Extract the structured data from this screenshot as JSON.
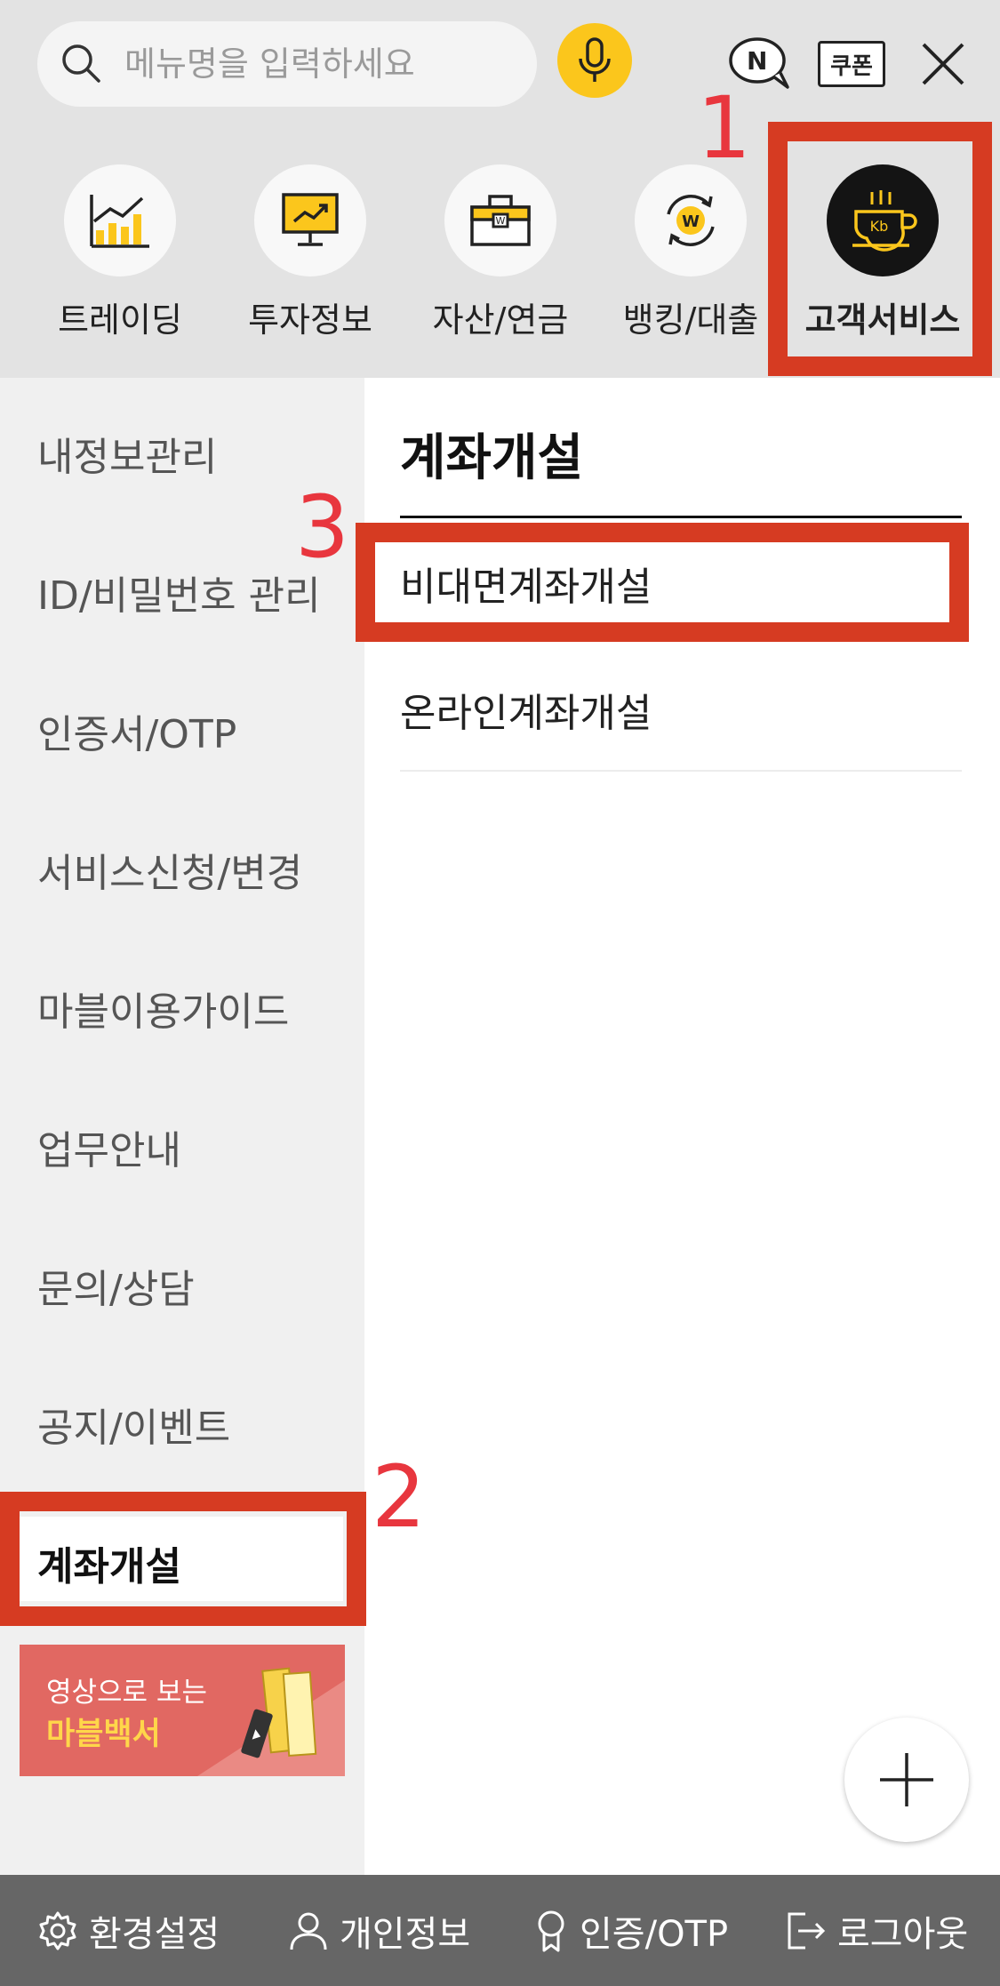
{
  "search": {
    "placeholder": "메뉴명을 입력하세요"
  },
  "header": {
    "coupon_label": "쿠폰",
    "n_badge": "N"
  },
  "categories": [
    {
      "label": "트레이딩",
      "icon": "chart-icon"
    },
    {
      "label": "투자정보",
      "icon": "monitor-chart-icon"
    },
    {
      "label": "자산/연금",
      "icon": "briefcase-won-icon"
    },
    {
      "label": "뱅킹/대출",
      "icon": "won-refresh-icon"
    },
    {
      "label": "고객서비스",
      "icon": "coffee-cup-icon",
      "active": true
    }
  ],
  "sidebar": {
    "items": [
      {
        "label": "내정보관리"
      },
      {
        "label": "ID/비밀번호 관리"
      },
      {
        "label": "인증서/OTP"
      },
      {
        "label": "서비스신청/변경"
      },
      {
        "label": "마블이용가이드"
      },
      {
        "label": "업무안내"
      },
      {
        "label": "문의/상담"
      },
      {
        "label": "공지/이벤트"
      },
      {
        "label": "계좌개설",
        "selected": true
      }
    ]
  },
  "banner": {
    "line1": "영상으로 보는",
    "line2": "마블백서"
  },
  "panel": {
    "title": "계좌개설",
    "items": [
      {
        "label": "비대면계좌개설"
      },
      {
        "label": "온라인계좌개설"
      }
    ]
  },
  "bottom_bar": [
    {
      "label": "환경설정",
      "icon": "gear-icon"
    },
    {
      "label": "개인정보",
      "icon": "person-icon"
    },
    {
      "label": "인증/OTP",
      "icon": "award-icon"
    },
    {
      "label": "로그아웃",
      "icon": "logout-icon"
    }
  ],
  "annotations": [
    "1",
    "2",
    "3"
  ],
  "colors": {
    "accent": "#fbc61c",
    "annotation_red": "#d63b22",
    "annotation_number": "#e8363e",
    "banner": "#e16862"
  }
}
